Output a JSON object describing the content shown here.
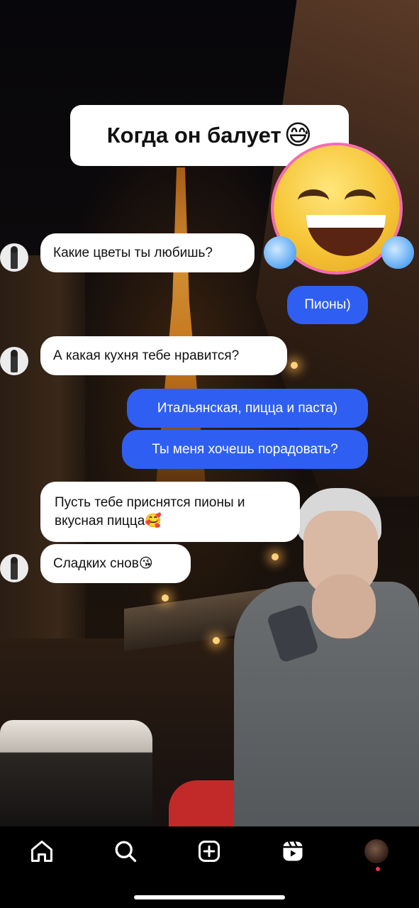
{
  "story": {
    "title": "Когда он балует",
    "title_emoji": "😅",
    "sticker": "face-with-tears-of-joy"
  },
  "chat": {
    "messages": [
      {
        "from": "them",
        "text": "Какие цветы ты любишь?"
      },
      {
        "from": "me",
        "text": "Пионы)"
      },
      {
        "from": "them",
        "text": "А какая кухня тебе нравится?"
      },
      {
        "from": "me",
        "text": "Итальянская, пицца и паста)"
      },
      {
        "from": "me",
        "text": "Ты меня хочешь порадовать?"
      },
      {
        "from": "them",
        "text": "Пусть тебе приснятся пионы и вкусная пицца🥰"
      },
      {
        "from": "them",
        "text": "Сладких снов😘"
      }
    ]
  },
  "nav": {
    "items": [
      {
        "icon": "home-icon"
      },
      {
        "icon": "search-icon"
      },
      {
        "icon": "create-icon"
      },
      {
        "icon": "reels-icon"
      },
      {
        "icon": "profile-avatar"
      }
    ],
    "notification": true
  },
  "colors": {
    "outgoing_bubble": "#2f5ff2",
    "incoming_bubble": "#ffffff",
    "nav_background": "#000000",
    "notification_dot": "#ff2d55"
  }
}
